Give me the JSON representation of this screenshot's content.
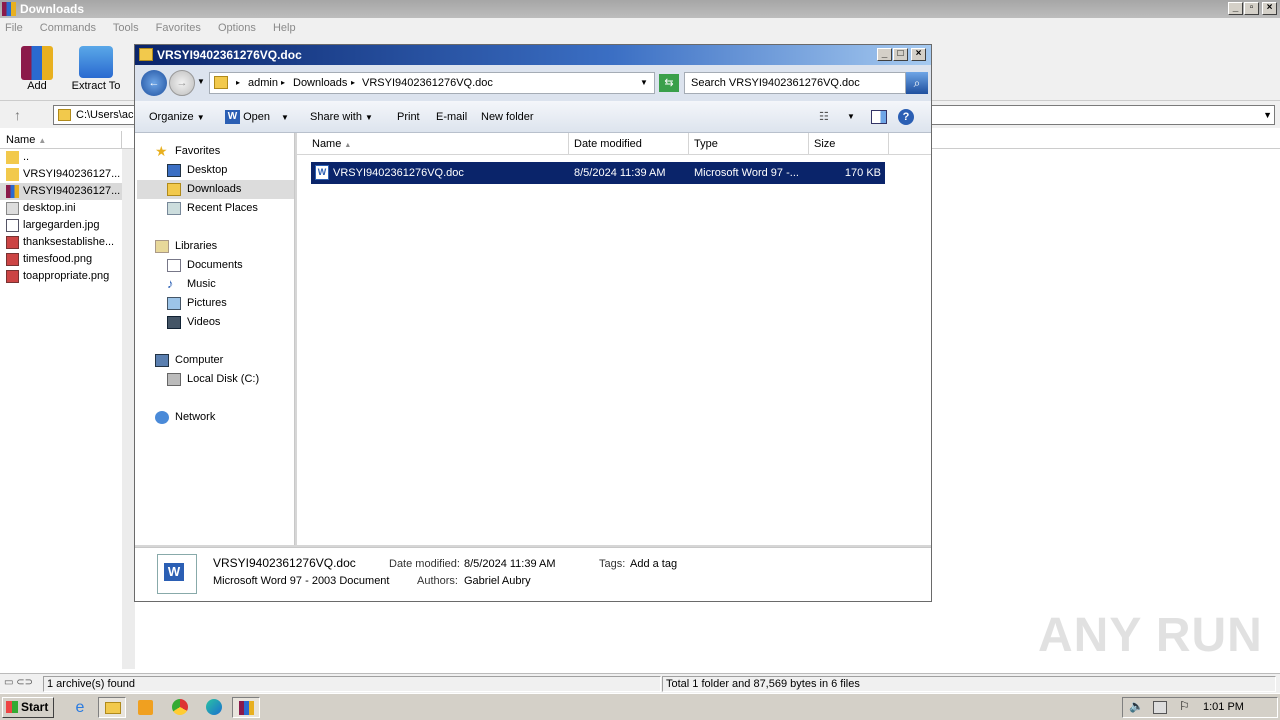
{
  "rar": {
    "title": "Downloads",
    "menu": [
      "File",
      "Commands",
      "Tools",
      "Favorites",
      "Options",
      "Help"
    ],
    "toolbar": {
      "add": "Add",
      "extract": "Extract To"
    },
    "address": "C:\\Users\\ac",
    "col_name": "Name",
    "files": [
      "..",
      "VRSYI940236127...",
      "VRSYI940236127...",
      "desktop.ini",
      "largegarden.jpg",
      "thanksestablishe...",
      "timesfood.png",
      "toappropriate.png"
    ],
    "status_left": "1 archive(s) found",
    "status_right": "Total 1 folder and 87,569 bytes in 6 files"
  },
  "explorer": {
    "title": "VRSYI9402361276VQ.doc",
    "breadcrumb": [
      "admin",
      "Downloads",
      "VRSYI9402361276VQ.doc"
    ],
    "search_placeholder": "Search VRSYI9402361276VQ.doc",
    "commands": {
      "organize": "Organize",
      "open": "Open",
      "share": "Share with",
      "print": "Print",
      "email": "E-mail",
      "newfolder": "New folder"
    },
    "nav": {
      "favorites": "Favorites",
      "desktop": "Desktop",
      "downloads": "Downloads",
      "recent": "Recent Places",
      "libraries": "Libraries",
      "documents": "Documents",
      "music": "Music",
      "pictures": "Pictures",
      "videos": "Videos",
      "computer": "Computer",
      "localdisk": "Local Disk (C:)",
      "network": "Network"
    },
    "columns": {
      "name": "Name",
      "date": "Date modified",
      "type": "Type",
      "size": "Size"
    },
    "row": {
      "name": "VRSYI9402361276VQ.doc",
      "date": "8/5/2024 11:39 AM",
      "type": "Microsoft Word 97 -...",
      "size": "170 KB"
    },
    "details": {
      "filename": "VRSYI9402361276VQ.doc",
      "filetype": "Microsoft Word 97 - 2003 Document",
      "date_label": "Date modified:",
      "date_value": "8/5/2024 11:39 AM",
      "tags_label": "Tags:",
      "tags_value": "Add a tag",
      "authors_label": "Authors:",
      "authors_value": "Gabriel Aubry"
    }
  },
  "taskbar": {
    "start": "Start",
    "clock": "1:01 PM"
  },
  "watermark": "ANY RUN"
}
